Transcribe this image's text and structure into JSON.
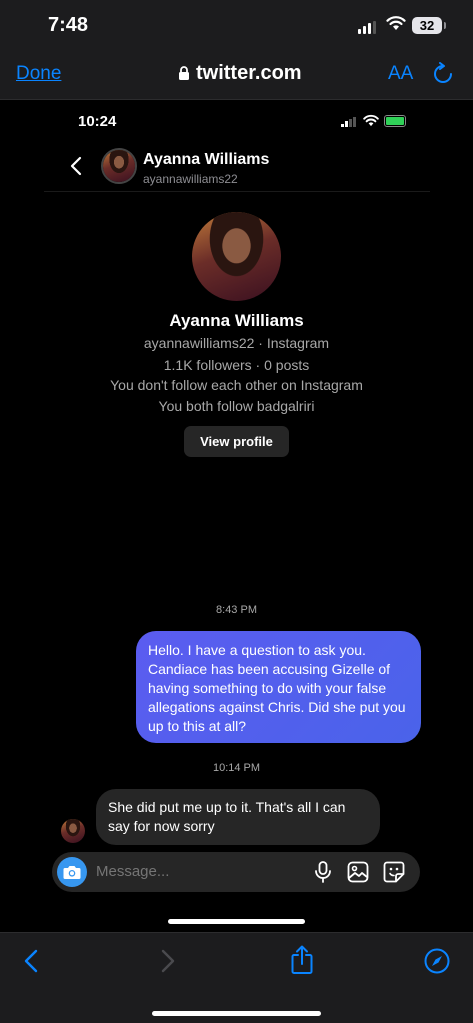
{
  "outer_status": {
    "time": "7:48",
    "battery": "32"
  },
  "safari": {
    "done_label": "Done",
    "url": "twitter.com",
    "text_size_label": "AA"
  },
  "inner_status": {
    "time": "10:24"
  },
  "dm_header": {
    "name": "Ayanna Williams",
    "username": "ayannawilliams22"
  },
  "profile": {
    "name": "Ayanna Williams",
    "handle_line": "ayannawilliams22 · Instagram",
    "stats_line": "1.1K followers · 0 posts",
    "follow_status": "You don't follow each other on Instagram",
    "mutual": "You both follow badgalriri",
    "view_profile_label": "View profile"
  },
  "messages": [
    {
      "timestamp": "8:43 PM",
      "direction": "outgoing",
      "text": "Hello. I have a question to ask you. Candiace has been accusing Gizelle of having something to do with your false allegations against Chris. Did she put you up to this at all?"
    },
    {
      "timestamp": "10:14 PM",
      "direction": "incoming",
      "text": "She did put me up to it. That's all I can say for now sorry"
    }
  ],
  "composer": {
    "placeholder": "Message..."
  },
  "colors": {
    "accent": "#0a84ff",
    "outgoing_bubble": "#5b5cf0",
    "incoming_bubble": "#262626"
  }
}
